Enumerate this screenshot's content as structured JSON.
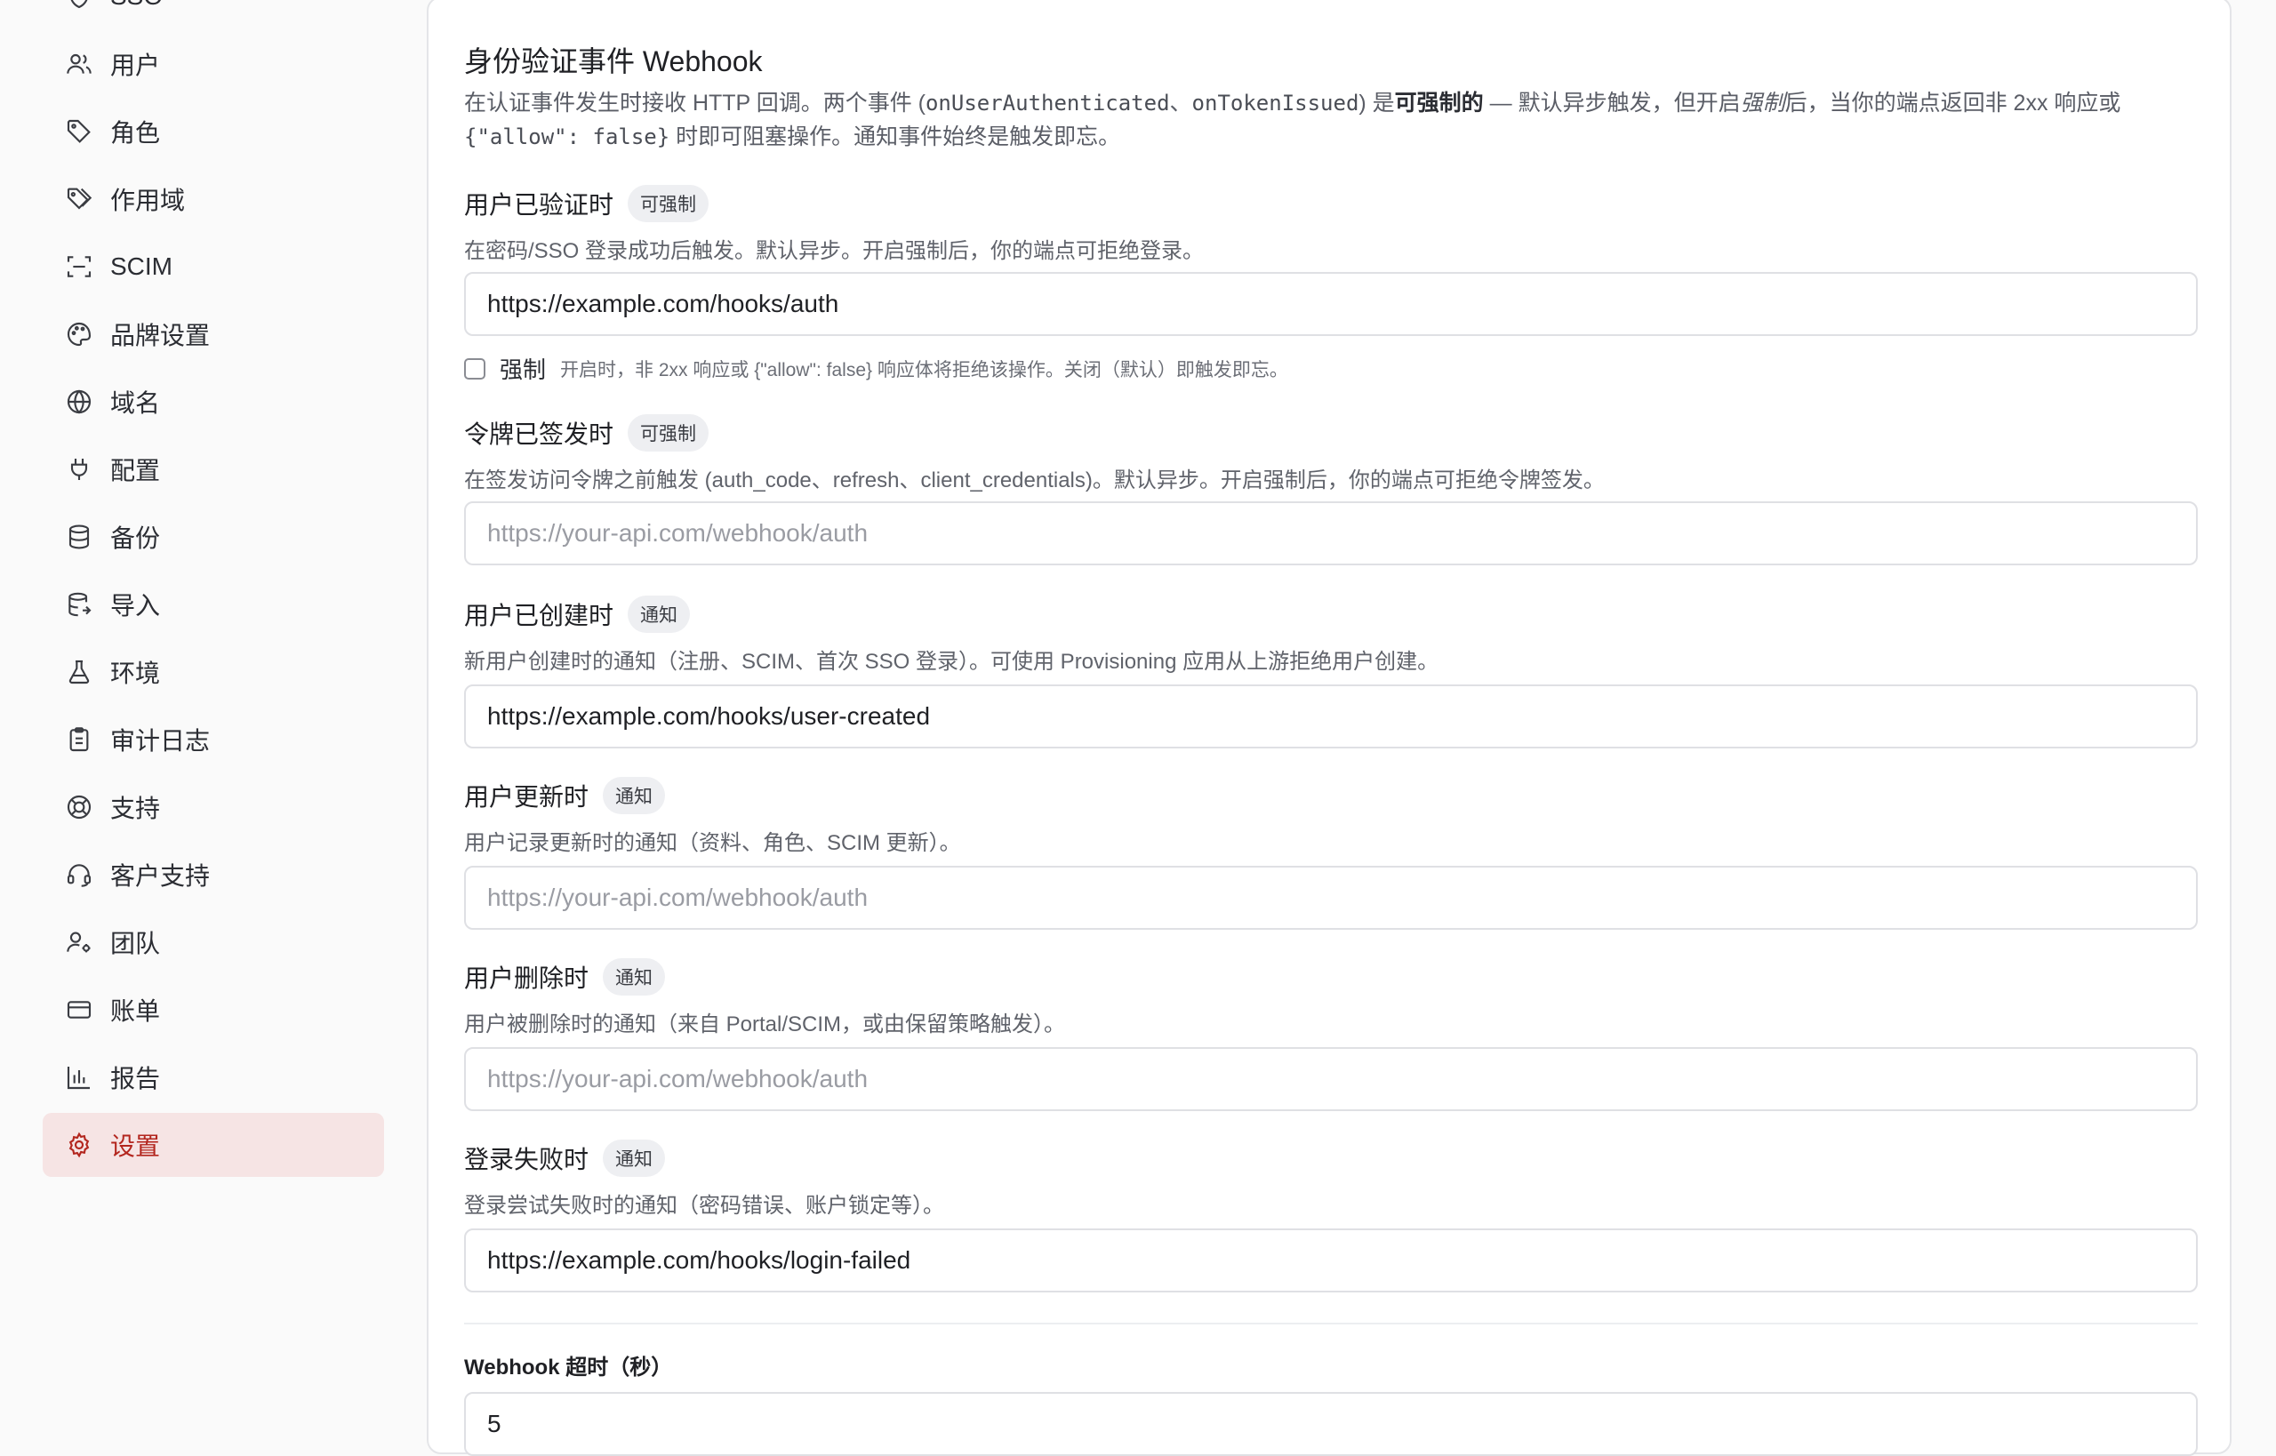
{
  "sidebar": {
    "partial_top_label": "SSO",
    "items": [
      {
        "label": "用户",
        "icon": "users-icon"
      },
      {
        "label": "角色",
        "icon": "tag-icon"
      },
      {
        "label": "作用域",
        "icon": "tags-icon"
      },
      {
        "label": "SCIM",
        "icon": "scan-icon"
      },
      {
        "label": "品牌设置",
        "icon": "palette-icon"
      },
      {
        "label": "域名",
        "icon": "globe-icon"
      },
      {
        "label": "配置",
        "icon": "plug-icon"
      },
      {
        "label": "备份",
        "icon": "database-icon"
      },
      {
        "label": "导入",
        "icon": "database-import-icon"
      },
      {
        "label": "环境",
        "icon": "flask-icon"
      },
      {
        "label": "审计日志",
        "icon": "clipboard-icon"
      },
      {
        "label": "支持",
        "icon": "lifebuoy-icon"
      },
      {
        "label": "客户支持",
        "icon": "headset-icon"
      },
      {
        "label": "团队",
        "icon": "user-cog-icon"
      },
      {
        "label": "账单",
        "icon": "credit-card-icon"
      },
      {
        "label": "报告",
        "icon": "bar-chart-icon"
      },
      {
        "label": "设置",
        "icon": "settings-gear-icon",
        "active": true
      }
    ]
  },
  "section": {
    "title": "身份验证事件 Webhook",
    "desc_part1": "在认证事件发生时接收 HTTP 回调。两个事件 (",
    "desc_code1": "onUserAuthenticated",
    "desc_sep": "、",
    "desc_code2": "onTokenIssued",
    "desc_part2": ") 是",
    "desc_bold": "可强制的",
    "desc_part3": " — 默认异步触发，但开启",
    "desc_italic": "强制",
    "desc_part4": "后，当你的端点返回非 2xx 响应或 ",
    "desc_code3": "{\"allow\": false}",
    "desc_part5": " 时即可阻塞操作。通知事件始终是触发即忘。"
  },
  "events": [
    {
      "title": "用户已验证时",
      "badge": "可强制",
      "desc": "在密码/SSO 登录成功后触发。默认异步。开启强制后，你的端点可拒绝登录。",
      "value": "https://example.com/hooks/auth",
      "placeholder": "https://your-api.com/webhook/auth",
      "enforce_label": "强制",
      "enforce_hint": "开启时，非 2xx 响应或 {\"allow\": false} 响应体将拒绝该操作。关闭（默认）即触发即忘。",
      "enforce_checked": false
    },
    {
      "title": "令牌已签发时",
      "badge": "可强制",
      "desc": "在签发访问令牌之前触发 (auth_code、refresh、client_credentials)。默认异步。开启强制后，你的端点可拒绝令牌签发。",
      "value": "",
      "placeholder": "https://your-api.com/webhook/auth"
    },
    {
      "title": "用户已创建时",
      "badge": "通知",
      "desc": "新用户创建时的通知（注册、SCIM、首次 SSO 登录）。可使用 Provisioning 应用从上游拒绝用户创建。",
      "value": "https://example.com/hooks/user-created",
      "placeholder": "https://your-api.com/webhook/auth"
    },
    {
      "title": "用户更新时",
      "badge": "通知",
      "desc": "用户记录更新时的通知（资料、角色、SCIM 更新）。",
      "value": "",
      "placeholder": "https://your-api.com/webhook/auth"
    },
    {
      "title": "用户删除时",
      "badge": "通知",
      "desc": "用户被删除时的通知（来自 Portal/SCIM，或由保留策略触发）。",
      "value": "",
      "placeholder": "https://your-api.com/webhook/auth"
    },
    {
      "title": "登录失败时",
      "badge": "通知",
      "desc": "登录尝试失败时的通知（密码错误、账户锁定等）。",
      "value": "https://example.com/hooks/login-failed",
      "placeholder": "https://your-api.com/webhook/auth"
    }
  ],
  "timeout": {
    "label": "Webhook 超时（秒）",
    "value": "5"
  },
  "colors": {
    "active_bg": "#f6e4e4",
    "active_text": "#b3261e"
  }
}
